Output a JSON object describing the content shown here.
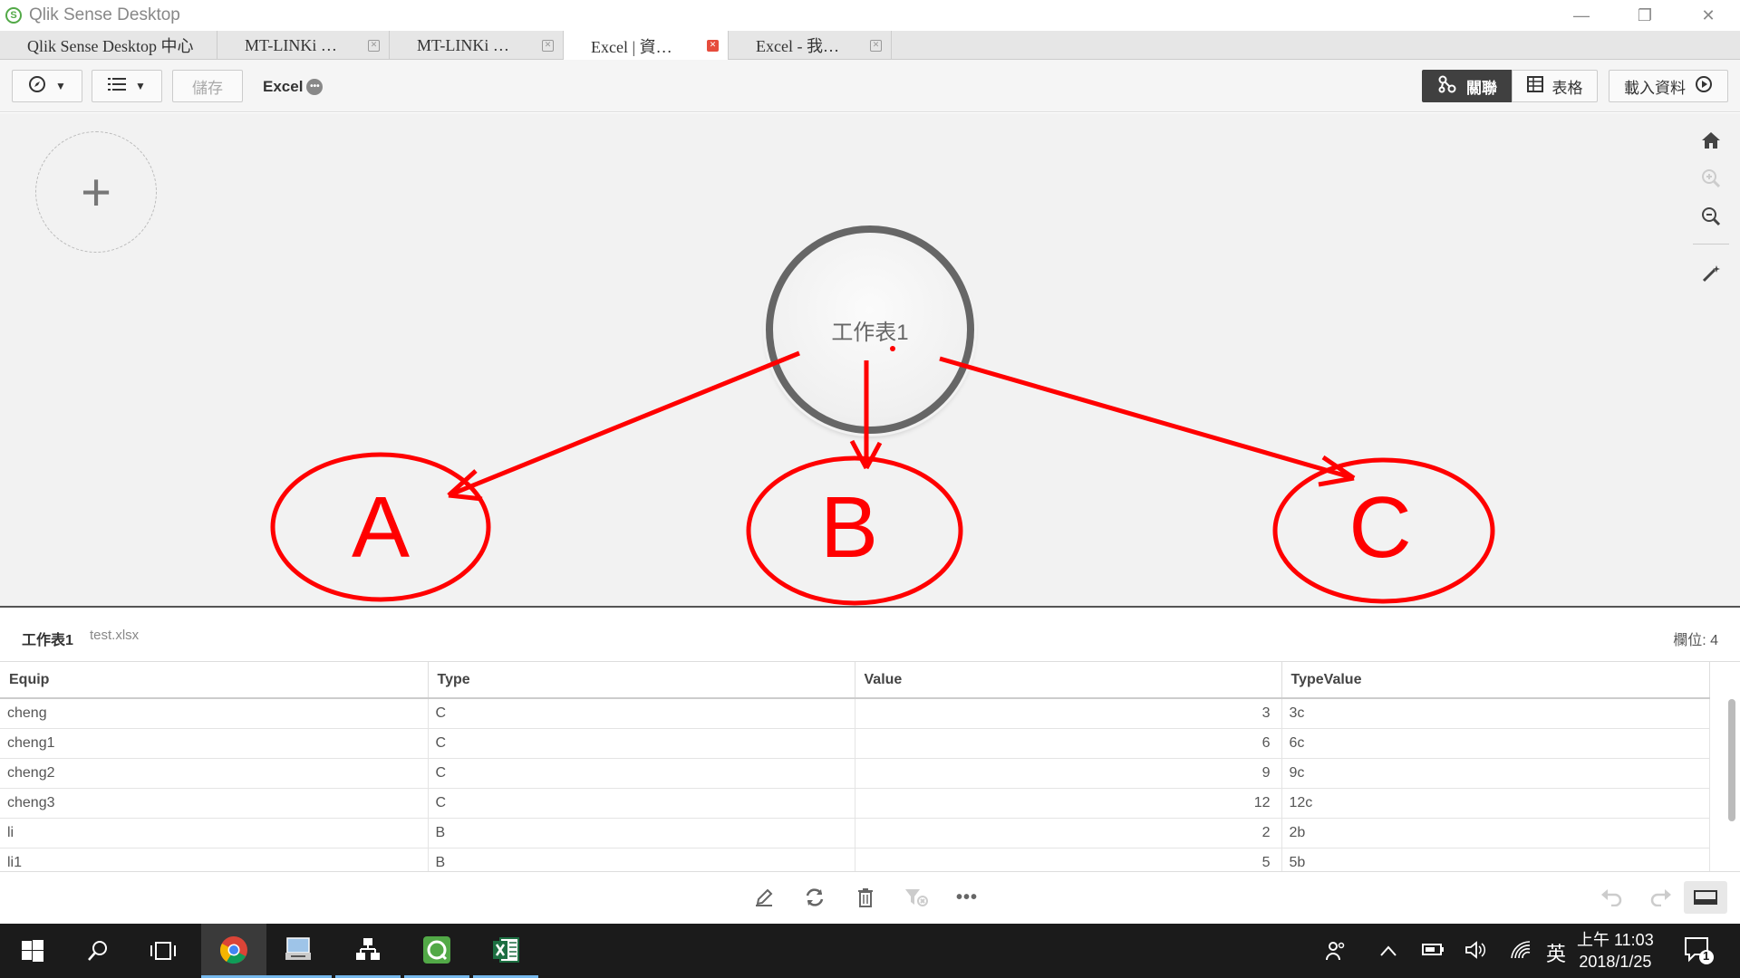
{
  "window": {
    "title": "Qlik Sense Desktop",
    "logo": "S",
    "controls": {
      "minimize": "—",
      "restore": "❐",
      "close": "✕"
    }
  },
  "tabs": [
    {
      "label": "Qlik Sense Desktop 中心",
      "closable": false,
      "active": false
    },
    {
      "label": "MT-LINKi …",
      "closable": true,
      "active": false
    },
    {
      "label": "MT-LINKi …",
      "closable": true,
      "active": false
    },
    {
      "label": "Excel | 資…",
      "closable": true,
      "active": true
    },
    {
      "label": "Excel - 我…",
      "closable": true,
      "active": false
    }
  ],
  "toolbar": {
    "save_label": "儲存",
    "app_name": "Excel",
    "more_glyph": "•••",
    "associations_label": "關聯",
    "tables_label": "表格",
    "load_data_label": "載入資料"
  },
  "canvas": {
    "add_glyph": "+",
    "table_bubble": "工作表1",
    "annotations": [
      "A",
      "B",
      "C"
    ],
    "annotation_color": "#ff0000"
  },
  "preview": {
    "table_name": "工作表1",
    "file_name": "test.xlsx",
    "field_count": "欄位: 4",
    "columns": [
      "Equip",
      "Type",
      "Value",
      "TypeValue"
    ],
    "rows": [
      [
        "cheng",
        "C",
        "3",
        "3c"
      ],
      [
        "cheng1",
        "C",
        "6",
        "6c"
      ],
      [
        "cheng2",
        "C",
        "9",
        "9c"
      ],
      [
        "cheng3",
        "C",
        "12",
        "12c"
      ],
      [
        "li",
        "B",
        "2",
        "2b"
      ],
      [
        "li1",
        "B",
        "5",
        "5b"
      ]
    ]
  },
  "taskbar": {
    "ime": "英",
    "time": "上午 11:03",
    "date": "2018/1/25",
    "notification_count": "1"
  },
  "colors": {
    "accent_green": "#52a947",
    "dark_button": "#404040",
    "close_red": "#e64c3c"
  }
}
